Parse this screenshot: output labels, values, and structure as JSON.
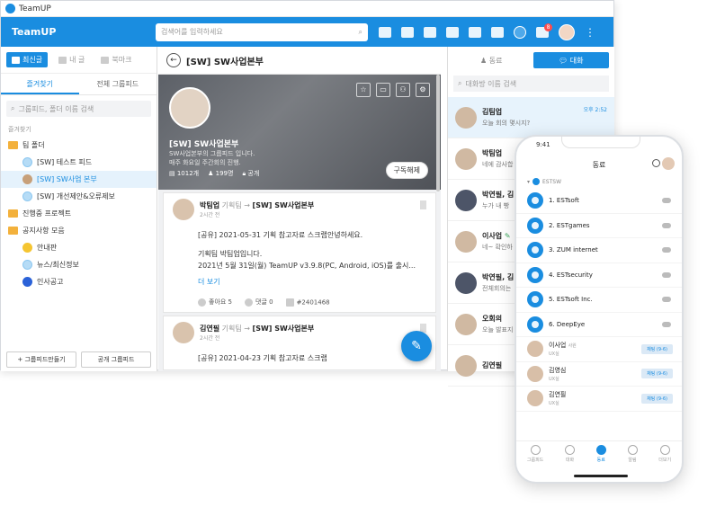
{
  "window": {
    "title": "TeamUP"
  },
  "header": {
    "brand": "TeamUP",
    "search_placeholder": "검색어를 입력하세요",
    "notif_count": "8"
  },
  "left": {
    "tabs": [
      {
        "label": "최신글"
      },
      {
        "label": "내 글"
      },
      {
        "label": "북마크"
      }
    ],
    "subtabs": [
      {
        "label": "즐겨찾기"
      },
      {
        "label": "전체 그룹피드"
      }
    ],
    "search_placeholder": "그룹피드, 폴더 이름 검색",
    "fav_label": "즐겨찾기",
    "tree": [
      {
        "label": "팀 폴더"
      },
      {
        "label": "[SW] 테스트 피드"
      },
      {
        "label": "[SW] SW사업 본부"
      },
      {
        "label": "[SW] 개선제안&오류제보"
      },
      {
        "label": "진행중 프로젝트"
      },
      {
        "label": "공지사항 모음"
      },
      {
        "label": "안내판"
      },
      {
        "label": "뉴스/최신정보"
      },
      {
        "label": "인사공고"
      }
    ],
    "bottom_buttons": [
      {
        "label": "+ 그룹피드만들기"
      },
      {
        "label": "공개 그룹피드"
      }
    ]
  },
  "center": {
    "title": "[SW] SW사업본부",
    "cover": {
      "name": "[SW] SW사업본부",
      "desc1": "SW사업본부의 그룹피드 입니다.",
      "desc2": "매주 화요일 주간회의 진행.",
      "posts": "1012개",
      "members": "199명",
      "visibility": "공개",
      "subscribe_label": "구독해제"
    },
    "posts": [
      {
        "author": "박팀업",
        "team": "기획팀",
        "arrow": "→",
        "feed": "[SW] SW사업본부",
        "time": "2시간 전",
        "line1": "[공유] 2021-05-31 기획 참고자료 스크랩안녕하세요.",
        "line2": "기획팀 박팀업입니다.",
        "line3": "2021년 5월 31일(월) TeamUP v3.9.8(PC, Android, iOS)를 출시...",
        "more": "더 보기",
        "likes": "좋아요 5",
        "comments": "댓글 0",
        "id": "#2401468"
      },
      {
        "author": "김연필",
        "team": "기획팀",
        "arrow": "→",
        "feed": "[SW] SW사업본부",
        "time": "2시간 전",
        "line1": "[공유] 2021-04-23 기획 참고자료 스크랩"
      }
    ]
  },
  "right": {
    "tabs": [
      {
        "label": "동료"
      },
      {
        "label": "대화"
      }
    ],
    "search_placeholder": "대화방 이름 검색",
    "chats": [
      {
        "name": "김팀업",
        "msg": "오늘 회의 몇시지?",
        "time": "오후 2:52"
      },
      {
        "name": "박팀업",
        "msg": "네에 감사합"
      },
      {
        "name": "박연필, 김!",
        "msg": "누가 내 빵"
      },
      {
        "name": "이사업",
        "msg": "네~ 확인하"
      },
      {
        "name": "박연필, 김!",
        "msg": "전체회의는"
      },
      {
        "name": "오회의",
        "msg": "오늘 발표지"
      },
      {
        "name": "김연필",
        "msg": ""
      }
    ]
  },
  "phone": {
    "time": "9:41",
    "title": "동료",
    "org": "ESTSW",
    "list": [
      {
        "label": "1. ESTsoft"
      },
      {
        "label": "2. ESTgames"
      },
      {
        "label": "3. ZUM internet"
      },
      {
        "label": "4. ESTsecurity"
      },
      {
        "label": "5. ESTsoft Inc."
      },
      {
        "label": "6. DeepEye"
      }
    ],
    "people": [
      {
        "name": "이사업",
        "role": "사원",
        "dept": "UX실",
        "tag": "채팅 (9-6)"
      },
      {
        "name": "김영심",
        "dept": "UX실",
        "tag": "채팅 (9-6)"
      },
      {
        "name": "김연필",
        "dept": "UX실",
        "tag": "채팅 (9-6)"
      }
    ],
    "nav": [
      {
        "label": "그룹피드"
      },
      {
        "label": "대화"
      },
      {
        "label": "동료"
      },
      {
        "label": "알림"
      },
      {
        "label": "더보기"
      }
    ]
  }
}
